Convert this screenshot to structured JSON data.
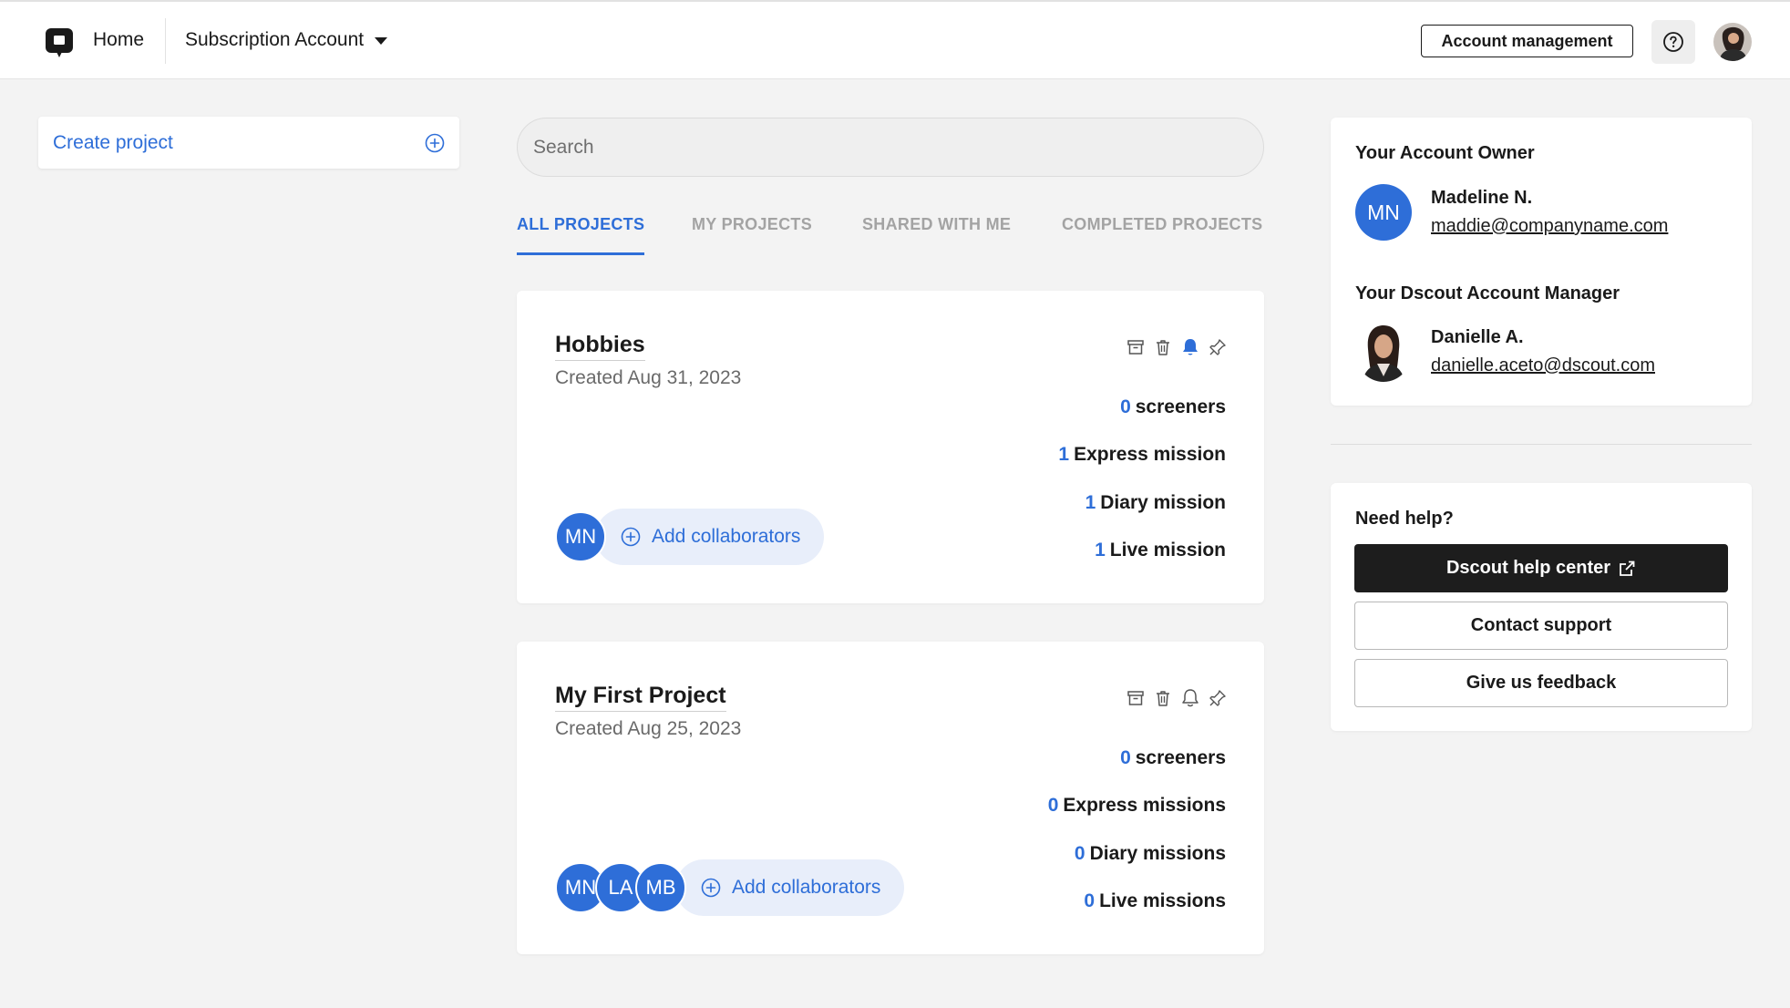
{
  "topbar": {
    "home_label": "Home",
    "account_label": "Subscription Account",
    "account_management_label": "Account management"
  },
  "sidebar": {
    "create_project_label": "Create project"
  },
  "search": {
    "placeholder": "Search"
  },
  "tabs": [
    {
      "label": "ALL PROJECTS",
      "active": true
    },
    {
      "label": "MY PROJECTS",
      "active": false
    },
    {
      "label": "SHARED WITH ME",
      "active": false
    },
    {
      "label": "COMPLETED PROJECTS",
      "active": false
    }
  ],
  "projects": [
    {
      "title": "Hobbies",
      "created": "Created Aug 31, 2023",
      "notifications_on": true,
      "stats": [
        {
          "num": "0",
          "label": "screeners"
        },
        {
          "num": "1",
          "label": "Express mission"
        },
        {
          "num": "1",
          "label": "Diary mission"
        },
        {
          "num": "1",
          "label": "Live mission"
        }
      ],
      "collaborators": [
        "MN"
      ],
      "add_collaborators_label": "Add collaborators"
    },
    {
      "title": "My First Project",
      "created": "Created Aug 25, 2023",
      "notifications_on": false,
      "stats": [
        {
          "num": "0",
          "label": "screeners"
        },
        {
          "num": "0",
          "label": "Express missions"
        },
        {
          "num": "0",
          "label": "Diary missions"
        },
        {
          "num": "0",
          "label": "Live missions"
        }
      ],
      "collaborators": [
        "MN",
        "LA",
        "MB"
      ],
      "add_collaborators_label": "Add collaborators"
    }
  ],
  "account_panel": {
    "owner_heading": "Your Account Owner",
    "owner_initials": "MN",
    "owner_name": "Madeline N.",
    "owner_email": "maddie@companyname.com",
    "manager_heading": "Your Dscout Account Manager",
    "manager_name": "Danielle A.",
    "manager_email": "danielle.aceto@dscout.com"
  },
  "help_panel": {
    "heading": "Need help?",
    "help_center_label": "Dscout help center",
    "contact_support_label": "Contact support",
    "feedback_label": "Give us feedback"
  },
  "colors": {
    "accent": "#2e6ed8",
    "dark_button": "#1d1d1d",
    "background": "#f3f3f3"
  }
}
